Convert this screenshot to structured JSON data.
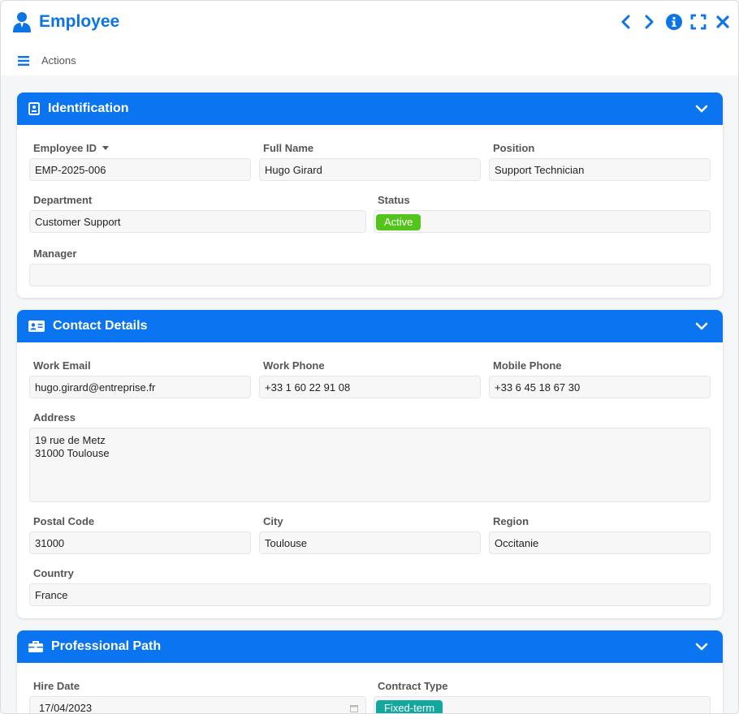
{
  "window": {
    "title": "Employee",
    "toolbar_label": "Actions"
  },
  "colors": {
    "accent": "#0b74f0",
    "status_active": "#52c41a",
    "contract_badge": "#13a89e"
  },
  "sections": {
    "identification": {
      "title": "Identification",
      "fields": {
        "employee_id": {
          "label": "Employee ID",
          "value": "EMP-2025-006"
        },
        "full_name": {
          "label": "Full Name",
          "value": "Hugo Girard"
        },
        "position": {
          "label": "Position",
          "value": "Support Technician"
        },
        "department": {
          "label": "Department",
          "value": "Customer Support"
        },
        "status": {
          "label": "Status",
          "value": "Active"
        },
        "manager": {
          "label": "Manager",
          "value": ""
        }
      }
    },
    "contact": {
      "title": "Contact Details",
      "fields": {
        "work_email": {
          "label": "Work Email",
          "value": "hugo.girard@entreprise.fr"
        },
        "work_phone": {
          "label": "Work Phone",
          "value": "+33 1 60 22 91 08"
        },
        "mobile_phone": {
          "label": "Mobile Phone",
          "value": "+33 6 45 18 67 30"
        },
        "address": {
          "label": "Address",
          "value": "19 rue de Metz\n31000 Toulouse"
        },
        "postal_code": {
          "label": "Postal Code",
          "value": "31000"
        },
        "city": {
          "label": "City",
          "value": "Toulouse"
        },
        "region": {
          "label": "Region",
          "value": "Occitanie"
        },
        "country": {
          "label": "Country",
          "value": "France"
        }
      }
    },
    "professional": {
      "title": "Professional Path",
      "fields": {
        "hire_date": {
          "label": "Hire Date",
          "value": "17/04/2023"
        },
        "contract_type": {
          "label": "Contract Type",
          "value": "Fixed-term"
        }
      }
    }
  }
}
